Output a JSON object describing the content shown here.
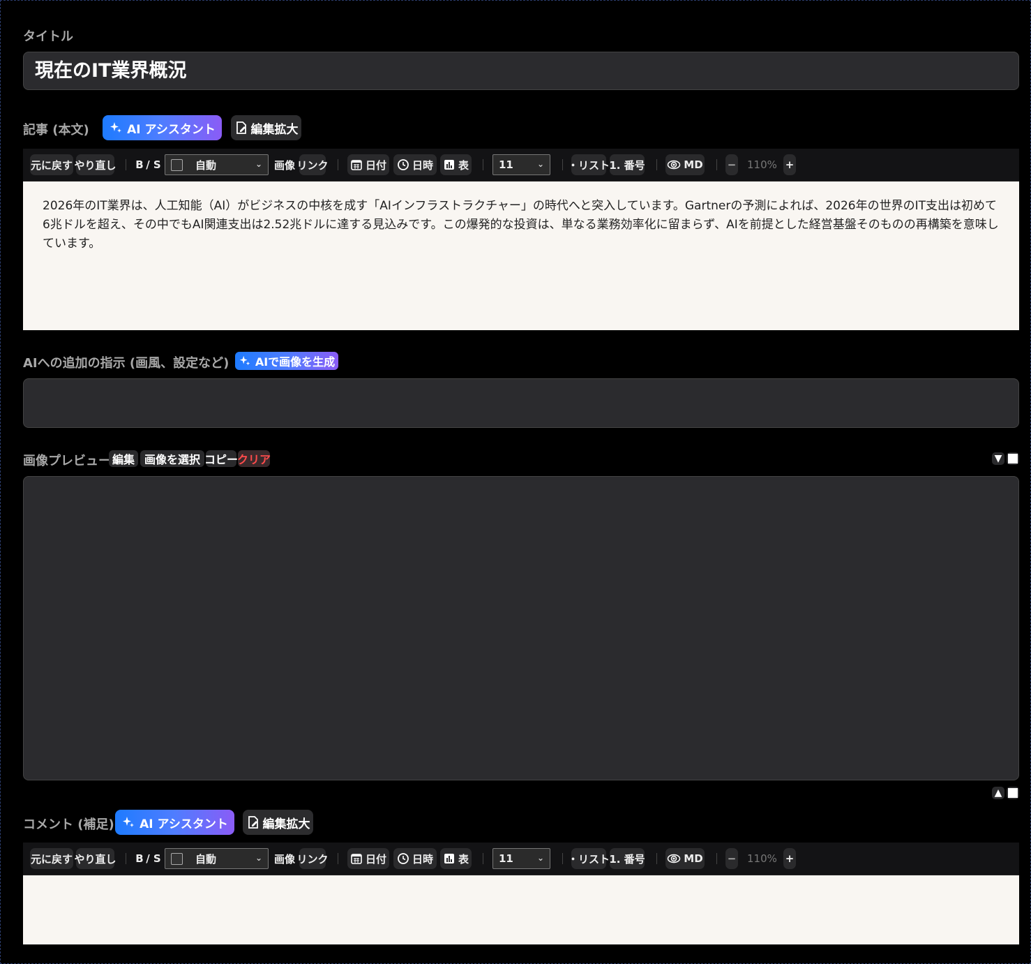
{
  "title_section": {
    "label": "タイトル",
    "value": "現在のIT業界概況"
  },
  "article": {
    "label": "記事 (本文)",
    "ai_button": "AI アシスタント",
    "expand_button": "編集拡大",
    "body": "2026年のIT業界は、人工知能（AI）がビジネスの中核を成す「AIインフラストラクチャー」の時代へと突入しています。Gartnerの予測によれば、2026年の世界のIT支出は初めて6兆ドルを超え、その中でもAI関連支出は2.52兆ドルに達する見込みです。この爆発的な投資は、単なる業務効率化に留まらず、AIを前提とした経営基盤そのものの再構築を意味しています。"
  },
  "toolbar": {
    "undo": "元に戻す",
    "redo": "やり直し",
    "bold": "B",
    "italic_strike": "/ S",
    "format_select": "自動",
    "image": "画像",
    "link": "リンク",
    "date": "日付",
    "datetime": "日時",
    "table": "表",
    "font_size": "11",
    "list": "・リスト",
    "numbered": "1. 番号",
    "md": "MD",
    "zoom_minus": "−",
    "zoom": "110%",
    "zoom_plus": "+"
  },
  "ai_instructions": {
    "label": "AIへの追加の指示 (画風、設定など)",
    "generate_button": "AIで画像を生成",
    "value": ""
  },
  "image_preview": {
    "label": "画像プレビュー",
    "edit": "編集",
    "select": "画像を選択",
    "copy": "コピー",
    "clear": "クリア"
  },
  "comment": {
    "label": "コメント (補足)",
    "ai_button": "AI アシスタント",
    "expand_button": "編集拡大",
    "body": ""
  },
  "colors": {
    "accent_start": "#1e7bff",
    "accent_end": "#8a5cf6",
    "danger": "#ff4b4b",
    "editor_bg": "#f9f6f2"
  }
}
